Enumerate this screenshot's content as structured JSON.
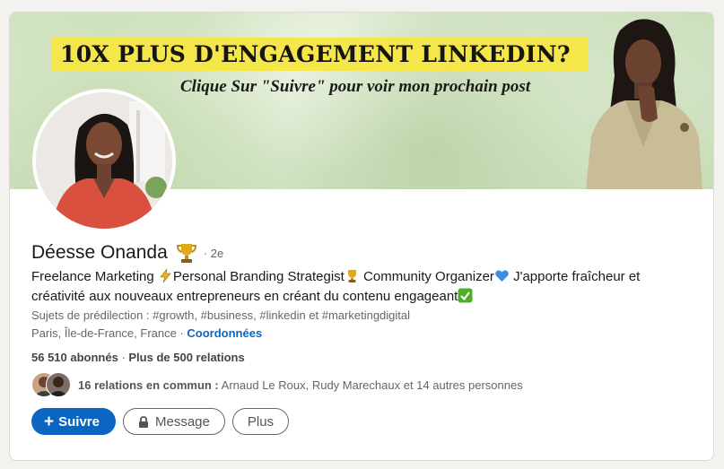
{
  "banner": {
    "headline": "10X PLUS D'ENGAGEMENT LINKEDIN?",
    "subline": "Clique Sur \"Suivre\" pour voir mon prochain post"
  },
  "profile": {
    "name": "Déesse Onanda",
    "degree": "· 2e",
    "headline_parts": [
      "Freelance Marketing ",
      "Personal Branding Strategist",
      " Community Organizer",
      " J'apporte fraîcheur et créativité aux nouveaux entrepreneurs en créant du contenu engageant"
    ],
    "topics": "Sujets de prédilection : #growth, #business, #linkedin et #marketingdigital",
    "location": "Paris, Île-de-France, France · ",
    "contact_link": "Coordonnées",
    "followers": "56 510 abonnés",
    "separator": " · ",
    "relations": "Plus de 500 relations",
    "mutual_bold": "16 relations en commun :",
    "mutual_rest": " Arnaud Le Roux, Rudy Marechaux et 14 autres personnes"
  },
  "actions": {
    "follow": "Suivre",
    "message": "Message",
    "more": "Plus"
  },
  "icons": {
    "trophy": "trophy-icon",
    "lightning": "lightning-icon",
    "heart": "blue-heart-icon",
    "check": "check-mark-icon",
    "lock": "lock-icon",
    "plus": "plus-icon"
  },
  "colors": {
    "accent": "#0a66c2",
    "banner_highlight": "#f5e64a",
    "page_bg": "#f3f2ef"
  }
}
